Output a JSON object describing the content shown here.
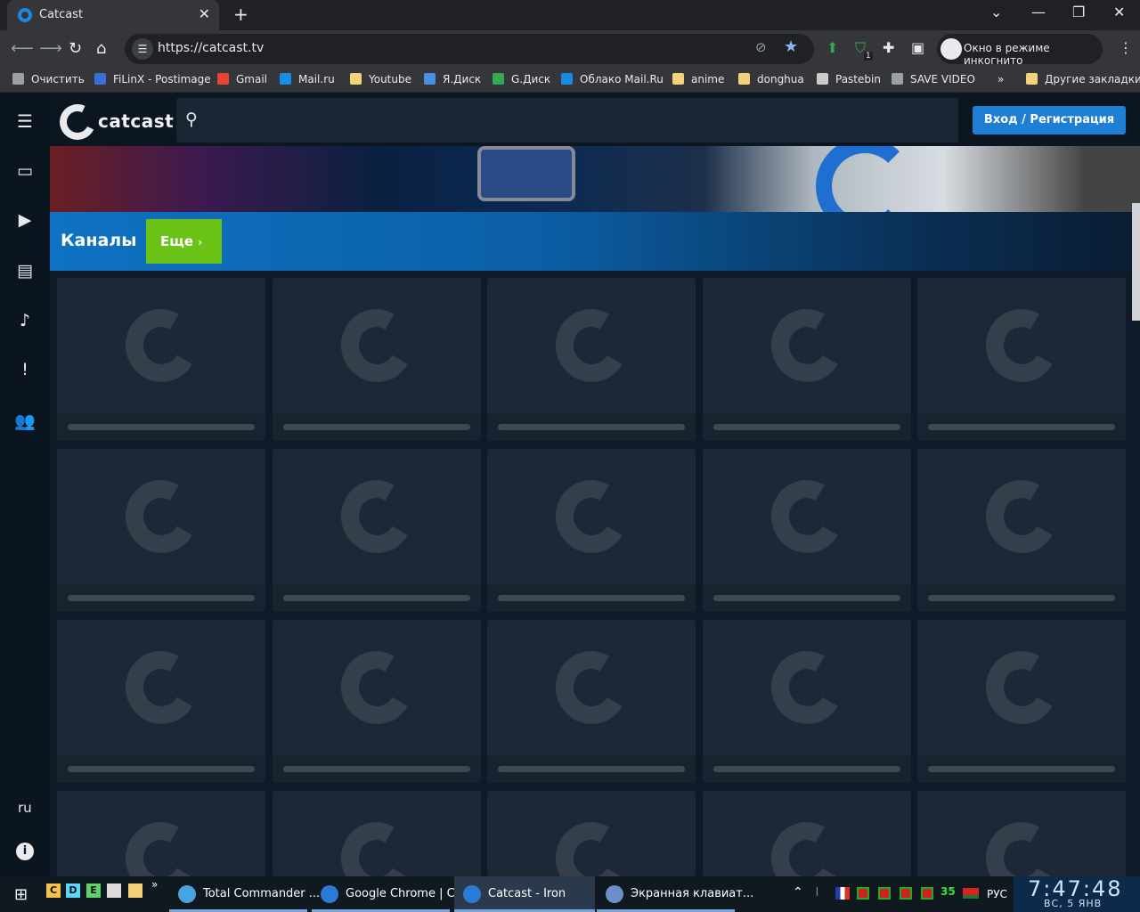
{
  "browser": {
    "tab_title": "Catcast",
    "tab_close": "✕",
    "new_tab": "+",
    "window_controls": [
      "⌄",
      "—",
      "❐",
      "✕"
    ],
    "url": "https://catcast.tv",
    "incognito_label": "Окно в режиме инкогнито",
    "extension_badge": "1"
  },
  "bookmarks": [
    {
      "label": "Очистить",
      "icon": "gear-icon",
      "color": "#9aa0a6"
    },
    {
      "label": "FiLinX - Postimage",
      "icon": "postimage-icon",
      "color": "#3b6fd8"
    },
    {
      "label": "Gmail",
      "icon": "gmail-icon",
      "color": "#ea4335"
    },
    {
      "label": "Mail.ru",
      "icon": "mailru-icon",
      "color": "#168de2"
    },
    {
      "label": "Youtube",
      "icon": "folder-icon",
      "color": "#f2d178"
    },
    {
      "label": "Я.Диск",
      "icon": "yadisk-icon",
      "color": "#4a90e2"
    },
    {
      "label": "G.Диск",
      "icon": "gdrive-icon",
      "color": "#34a853"
    },
    {
      "label": "Облако Mail.Ru",
      "icon": "cloud-icon",
      "color": "#168de2"
    },
    {
      "label": "anime",
      "icon": "folder-icon",
      "color": "#f2d178"
    },
    {
      "label": "donghua",
      "icon": "folder-icon",
      "color": "#f2d178"
    },
    {
      "label": "Pastebin",
      "icon": "pastebin-icon",
      "color": "#cccccc"
    },
    {
      "label": "SAVE VIDEO",
      "icon": "globe-icon",
      "color": "#9aa0a6"
    }
  ],
  "bookmarks_more": "»",
  "other_bookmarks": "Другие закладки",
  "site": {
    "logo_text": "catcast",
    "login_label": "Вход / Регистрация",
    "section_title": "Каналы",
    "more_label": "Еще",
    "more_chevron": "›",
    "lang": "ru",
    "info": "i",
    "sidebar_icons": [
      "tv-icon",
      "video-playlist-icon",
      "radio-icon",
      "music-note-icon",
      "feedback-icon",
      "people-icon"
    ]
  },
  "taskbar": {
    "quick_launch": [
      "C",
      "D",
      "E"
    ],
    "quick_more": "»",
    "tasks": [
      {
        "label": "Total Commander ...",
        "icon_color": "#4aa3df"
      },
      {
        "label": "Google Chrome | C...",
        "icon_color": "#2a7bd6"
      },
      {
        "label": "Catcast - Iron",
        "icon_color": "#2a7bd6"
      },
      {
        "label": "Экранная клавиат...",
        "icon_color": "#6b8fc9"
      }
    ],
    "tray_number": "35",
    "language": "РУС",
    "time": "7:47:48",
    "date": "ВС, 5   ЯНВ"
  },
  "colors": {
    "accent": "#1e7fd4",
    "more_button": "#6cc317",
    "page_bg": "#0e1a27"
  }
}
